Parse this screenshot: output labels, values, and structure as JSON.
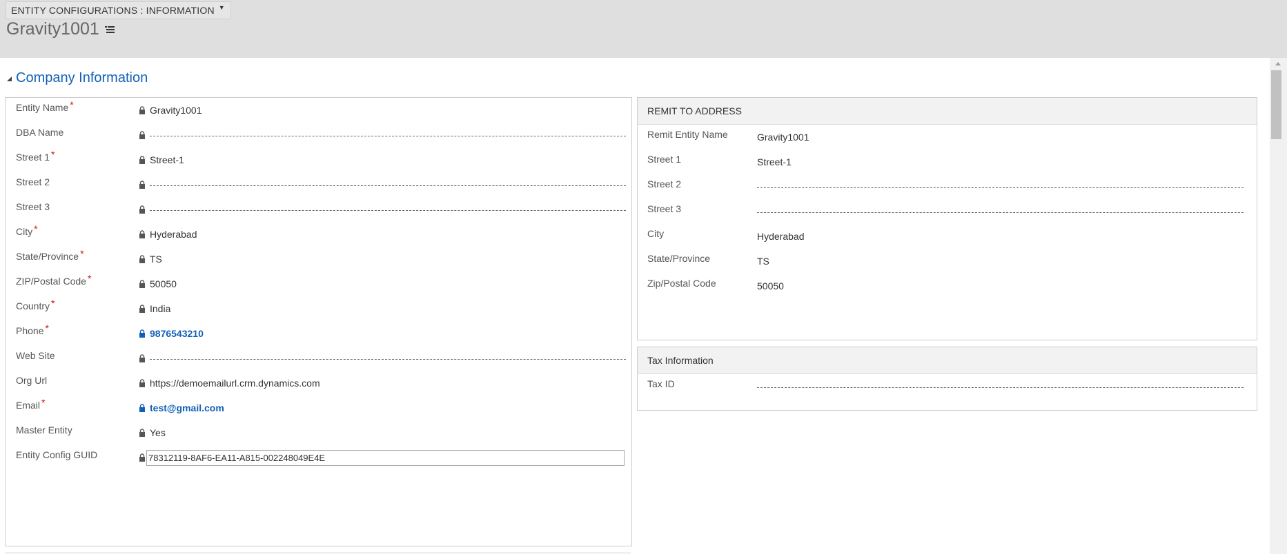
{
  "header": {
    "form_selector": "ENTITY CONFIGURATIONS : INFORMATION",
    "record_title": "Gravity1001"
  },
  "section": {
    "title": "Company Information"
  },
  "company_fields": [
    {
      "label": "Entity Name",
      "required": "*",
      "value": "Gravity1001"
    },
    {
      "label": "DBA Name",
      "required": "",
      "value": ""
    },
    {
      "label": "Street 1",
      "required": "*",
      "value": "Street-1"
    },
    {
      "label": "Street 2",
      "required": "",
      "value": ""
    },
    {
      "label": "Street 3",
      "required": "",
      "value": ""
    },
    {
      "label": "City",
      "required": "*",
      "value": "Hyderabad"
    },
    {
      "label": "State/Province",
      "required": "*",
      "value": "TS"
    },
    {
      "label": "ZIP/Postal Code",
      "required": "*",
      "value": "50050"
    },
    {
      "label": "Country",
      "required": "*",
      "value": "India"
    },
    {
      "label": "Phone",
      "required": "*",
      "value": "9876543210"
    },
    {
      "label": "Web Site",
      "required": "",
      "value": ""
    },
    {
      "label": "Org Url",
      "required": "",
      "value": "https://demoemailurl.crm.dynamics.com"
    },
    {
      "label": "Email",
      "required": "*",
      "value": "test@gmail.com"
    },
    {
      "label": "Master Entity",
      "required": "",
      "value": "Yes"
    },
    {
      "label": "Entity Config GUID",
      "required": "",
      "value": "78312119-8AF6-EA11-A815-002248049E4E"
    }
  ],
  "remit": {
    "title": "REMIT TO ADDRESS",
    "fields": [
      {
        "label": "Remit Entity Name",
        "value": "Gravity1001"
      },
      {
        "label": "Street 1",
        "value": "Street-1"
      },
      {
        "label": "Street 2",
        "value": ""
      },
      {
        "label": "Street 3",
        "value": ""
      },
      {
        "label": "City",
        "value": "Hyderabad"
      },
      {
        "label": "State/Province",
        "value": "TS"
      },
      {
        "label": "Zip/Postal Code",
        "value": "50050"
      }
    ]
  },
  "tax": {
    "title": "Tax Information",
    "fields": [
      {
        "label": "Tax ID",
        "value": ""
      }
    ]
  },
  "icons": {
    "lock": "lock-icon",
    "menu": "list-menu-icon",
    "caret": "caret-down-icon",
    "collapse": "collapse-triangle-icon"
  },
  "colors": {
    "header_bg": "#dfdfdf",
    "link": "#1160b7",
    "required": "#d01010"
  }
}
